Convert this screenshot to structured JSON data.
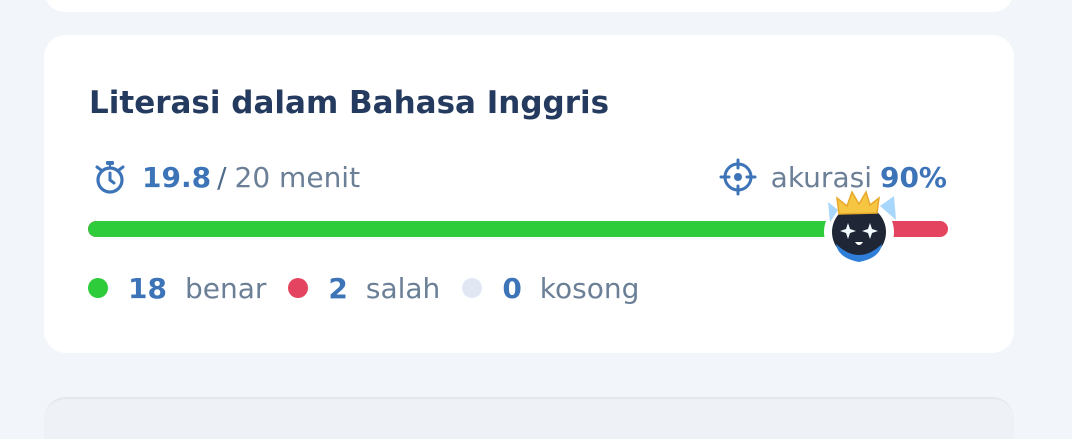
{
  "section": {
    "title": "Literasi dalam Bahasa Inggris",
    "time_value": "19.8",
    "time_separator": "/",
    "time_total": "20 menit",
    "accuracy_label": "akurasi",
    "accuracy_value": "90%",
    "progress": {
      "correct_fraction": 0.9,
      "wrong_fraction": 0.1
    },
    "legend": [
      {
        "count": "18",
        "label": "benar",
        "color": "#2ecc3a"
      },
      {
        "count": "2",
        "label": "salah",
        "color": "#e4445f"
      },
      {
        "count": "0",
        "label": "kosong",
        "color": "#e1e8f3"
      }
    ]
  },
  "icons": {
    "timer": "stopwatch-icon",
    "accuracy": "target-crosshair-icon",
    "mascot": "mascot-with-crown-icon"
  },
  "colors": {
    "title": "#243a5e",
    "accent_number": "#3d74b8",
    "muted_text": "#6b7f97",
    "correct": "#2ecc3a",
    "wrong": "#e4445f",
    "empty": "#e1e8f3"
  }
}
